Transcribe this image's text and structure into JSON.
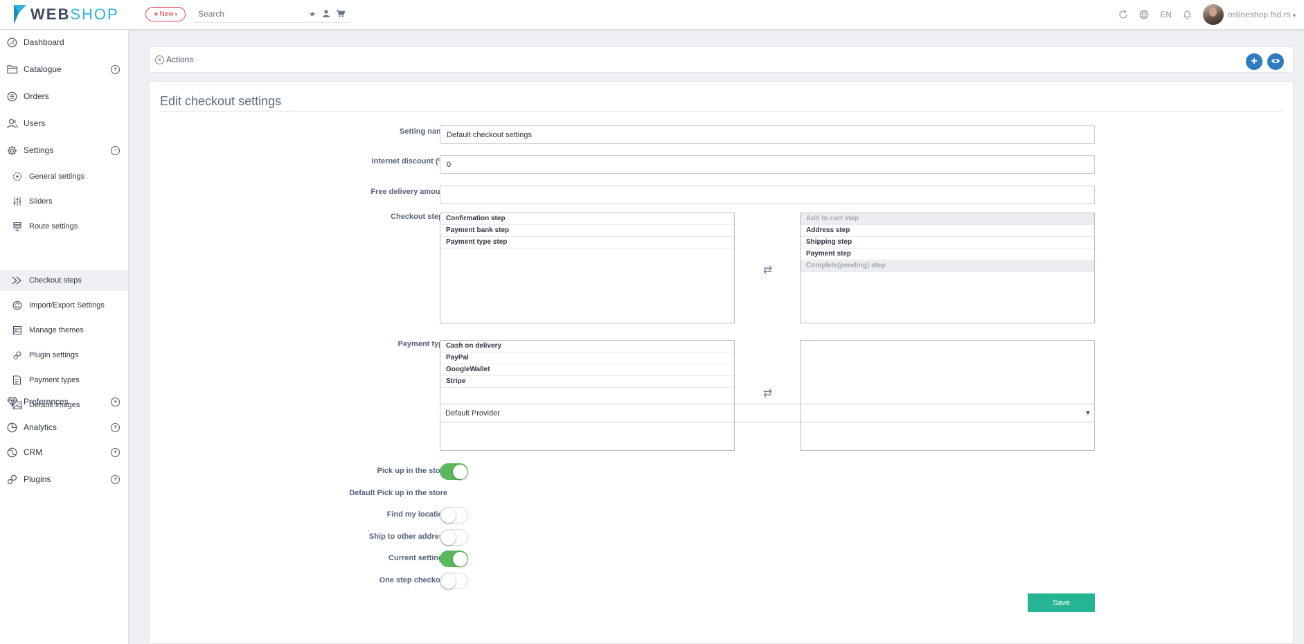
{
  "header": {
    "logo_web": "WEB",
    "logo_shop": "SHOP",
    "new_label": "New",
    "search_placeholder": "Search",
    "language": "EN",
    "user": "onlineshop.fsd.rs"
  },
  "sidebar": {
    "items": [
      {
        "label": "Dashboard",
        "icon": "dashboard-icon"
      },
      {
        "label": "Catalogue",
        "icon": "folder-icon",
        "toggle": "+"
      },
      {
        "label": "Orders",
        "icon": "orders-icon"
      },
      {
        "label": "Users",
        "icon": "users-icon"
      },
      {
        "label": "Settings",
        "icon": "gear-icon",
        "toggle": "−"
      },
      {
        "label": "Preferences",
        "icon": "diamond-icon",
        "toggle": "+"
      },
      {
        "label": "Analytics",
        "icon": "pie-chart-icon",
        "toggle": "+"
      },
      {
        "label": "CRM",
        "icon": "globe-icon",
        "toggle": "+"
      },
      {
        "label": "Plugins",
        "icon": "plugin-icon",
        "toggle": "+"
      }
    ],
    "sub_items": [
      {
        "label": "General settings",
        "icon": "general-settings-icon"
      },
      {
        "label": "Sliders",
        "icon": "sliders-icon"
      },
      {
        "label": "Route settings",
        "icon": "route-icon"
      },
      {
        "label": "Checkout steps",
        "icon": "checkout-steps-icon",
        "active": true
      },
      {
        "label": "Import/Export Settings",
        "icon": "import-export-icon"
      },
      {
        "label": "Manage themes",
        "icon": "themes-icon"
      },
      {
        "label": "Plugin settings",
        "icon": "plugin-settings-icon"
      },
      {
        "label": "Payment types",
        "icon": "payment-types-icon"
      },
      {
        "label": "Default images",
        "icon": "images-icon"
      }
    ]
  },
  "actions": {
    "label": "Actions"
  },
  "form": {
    "title": "Edit checkout settings",
    "setting_name_label": "Setting name",
    "setting_name_value": "Default checkout settings",
    "internet_discount_label": "Internet discount (%)",
    "internet_discount_value": "0",
    "free_delivery_label": "Free delivery amount",
    "free_delivery_value": "",
    "checkout_steps_label": "Checkout steps",
    "checkout_steps_available": [
      "Confirmation step",
      "Payment bank step",
      "Payment type step"
    ],
    "checkout_steps_selected": [
      {
        "label": "Add to cart step",
        "disabled": true
      },
      {
        "label": "Address step",
        "disabled": false
      },
      {
        "label": "Shipping step",
        "disabled": false
      },
      {
        "label": "Payment step",
        "disabled": false
      },
      {
        "label": "Complete(pending) step",
        "disabled": true
      }
    ],
    "payment_type_label": "Payment type",
    "payment_types_available": [
      "Cash on delivery",
      "PayPal",
      "GoogleWallet",
      "Stripe"
    ],
    "payment_types_selected": [],
    "pickup_label": "Pick up in the store",
    "pickup_on": true,
    "default_pickup_label": "Default Pick up in the store",
    "default_pickup_value": "Default Provider",
    "find_location_label": "Find my location",
    "find_location_on": false,
    "ship_other_label": "Ship to other address",
    "ship_other_on": false,
    "current_settings_label": "Current settings",
    "current_settings_on": true,
    "one_step_label": "One step checkout",
    "one_step_on": false,
    "save_label": "Save"
  },
  "colors": {
    "accent_blue": "#2e7bbf",
    "save_green": "#26b594",
    "toggle_green": "#5cb85c",
    "new_red": "#e2434b",
    "logo_blue": "#2ab3d9"
  }
}
